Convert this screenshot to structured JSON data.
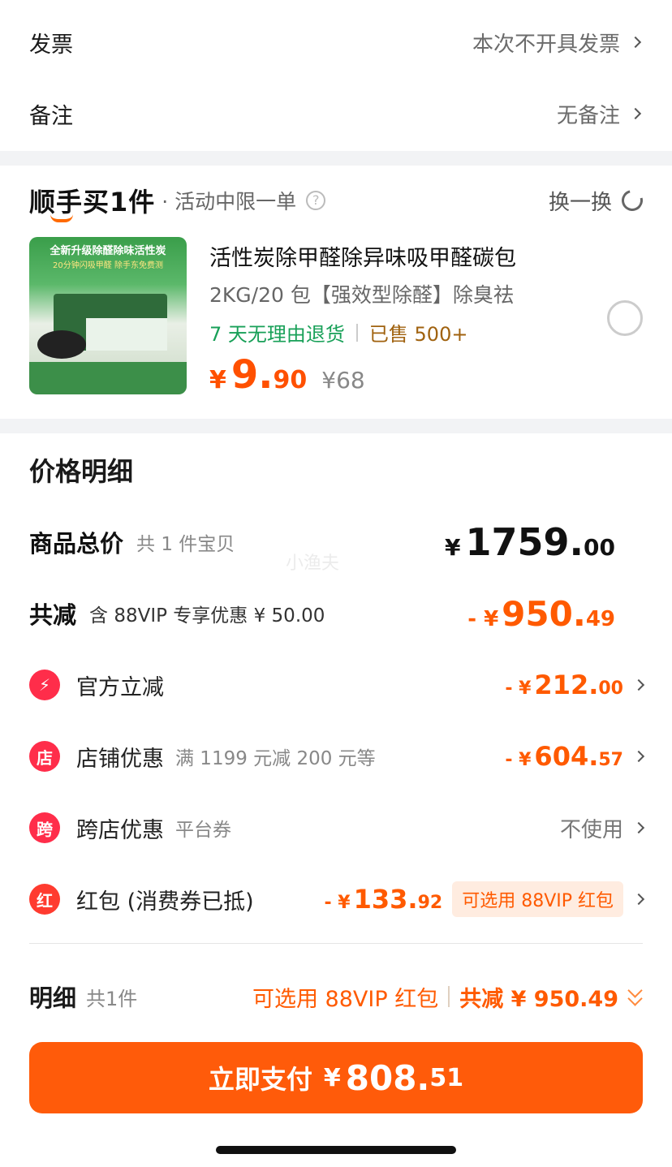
{
  "invoice": {
    "label": "发票",
    "value": "本次不开具发票"
  },
  "remark": {
    "label": "备注",
    "value": "无备注"
  },
  "addon": {
    "title": "顺手买1件",
    "subtitle": "· 活动中限一单",
    "help": "?",
    "swap": "换一换",
    "product": {
      "image_banner": "全新升级除醛除味活性炭",
      "image_banner2": "20分钟闪吸甲醛 除手东免费测",
      "title": "活性炭除甲醛除异味吸甲醛碳包",
      "spec": "2KG/20 包【强效型除醛】除臭祛",
      "return_policy": "7 天无理由退货",
      "sold": "已售 500+",
      "price_currency": "¥",
      "price_int": "9.",
      "price_dec": "90",
      "orig_price": "¥68"
    }
  },
  "price_detail": {
    "title": "价格明细",
    "total": {
      "label": "商品总价",
      "sub": "共 1 件宝贝",
      "cur": "¥",
      "int": "1759.",
      "dec": "00"
    },
    "discount": {
      "label": "共减",
      "sub": "含 88VIP 专享优惠 ¥ 50.00",
      "prefix": "- ¥",
      "int": "950.",
      "dec": "49"
    },
    "items": [
      {
        "icon": "⚡",
        "label": "官方立减",
        "sub": "",
        "prefix": "- ¥",
        "int": "212.",
        "dec": "00"
      },
      {
        "icon": "店",
        "label": "店铺优惠",
        "sub": "满 1199 元减 200 元等",
        "prefix": "- ¥",
        "int": "604.",
        "dec": "57"
      },
      {
        "icon": "跨",
        "label": "跨店优惠",
        "sub": "平台券",
        "value": "不使用"
      },
      {
        "icon": "红",
        "label": "红包 (消费券已抵)",
        "prefix": "- ¥",
        "int": "133.",
        "dec": "92",
        "chip": "可选用 88VIP 红包"
      }
    ],
    "watermark": "小渔夫"
  },
  "summary": {
    "label": "明细",
    "count": "共1件",
    "vip": "可选用 88VIP 红包",
    "total_discount": "共减 ¥ 950.49"
  },
  "pay": {
    "label": "立即支付",
    "cur": "¥",
    "int": "808.",
    "dec": "51"
  },
  "colors": {
    "accent": "#ff5b0a",
    "green": "#18a058",
    "red_icon": "#ff2d4a"
  }
}
